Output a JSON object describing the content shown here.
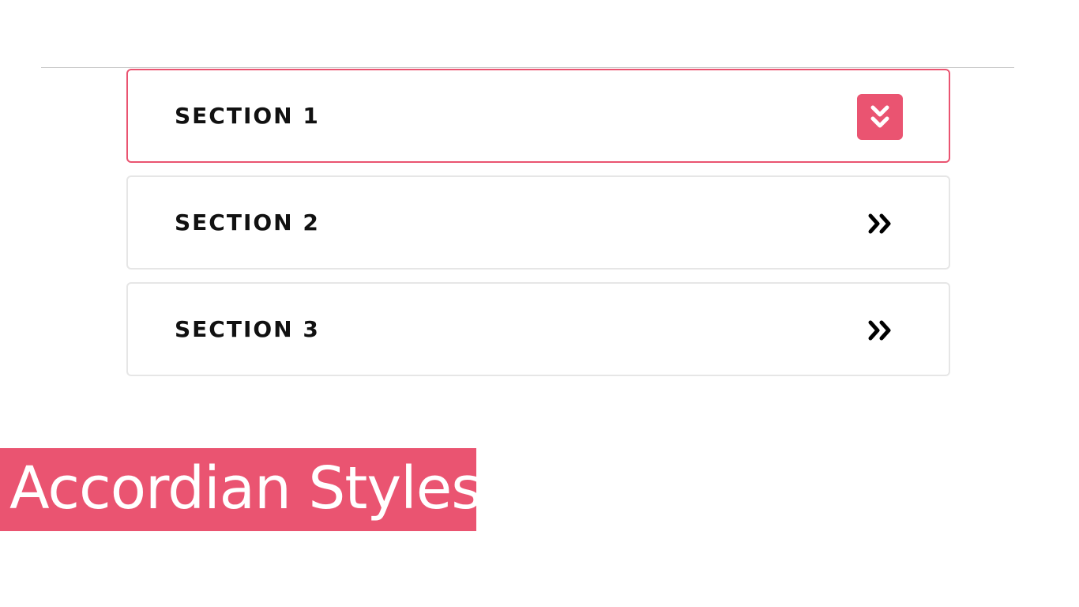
{
  "accordion": {
    "items": [
      {
        "title": "SECTION 1",
        "state": "expanded",
        "icon": "chevrons-down-icon"
      },
      {
        "title": "SECTION 2",
        "state": "collapsed",
        "icon": "chevrons-right-icon"
      },
      {
        "title": "SECTION 3",
        "state": "collapsed",
        "icon": "chevrons-right-icon"
      }
    ]
  },
  "caption": {
    "text": "Accordian Styles"
  },
  "colors": {
    "accent": "#ea5471",
    "border": "#e6e6e6",
    "text": "#111111",
    "divider": "#c8c8c8"
  }
}
